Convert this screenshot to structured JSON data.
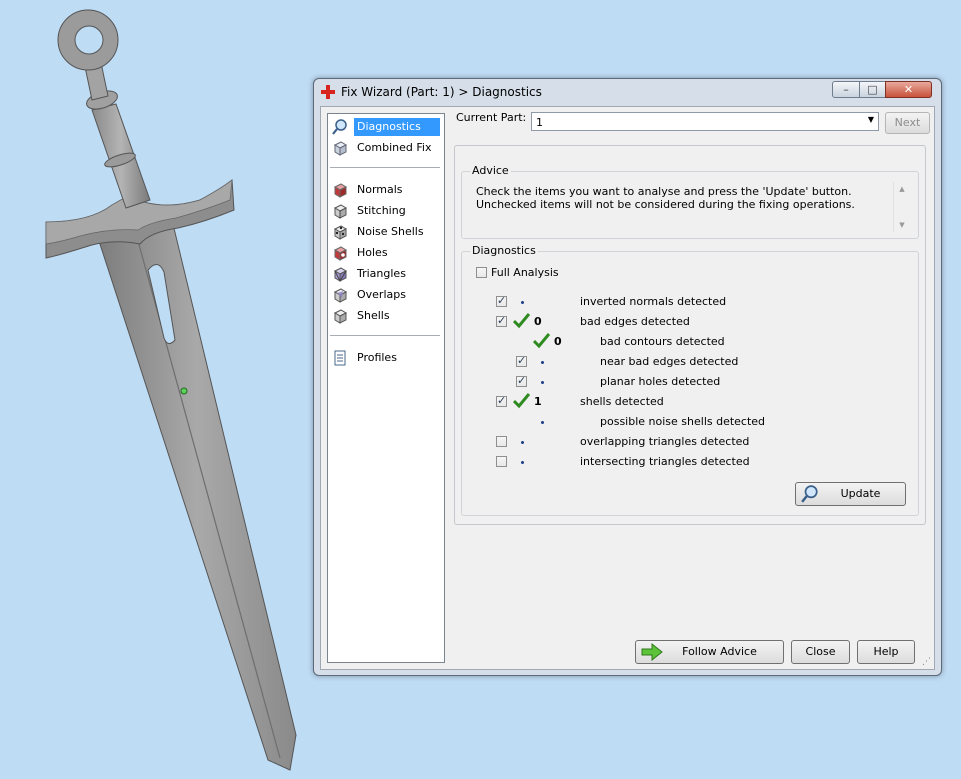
{
  "window": {
    "title": "Fix Wizard (Part: 1) > Diagnostics",
    "controls": {
      "minimize": "–",
      "maximize": "□",
      "close": "✕"
    }
  },
  "sidebar": {
    "top_items": [
      {
        "label": "Diagnostics",
        "icon": "magnifier-icon",
        "selected": true
      },
      {
        "label": "Combined Fix",
        "icon": "cube-icon"
      }
    ],
    "fix_items": [
      {
        "label": "Normals",
        "icon": "normals-cube-icon"
      },
      {
        "label": "Stitching",
        "icon": "stitching-cube-icon"
      },
      {
        "label": "Noise Shells",
        "icon": "noise-shells-icon"
      },
      {
        "label": "Holes",
        "icon": "holes-cube-icon"
      },
      {
        "label": "Triangles",
        "icon": "triangles-cube-icon"
      },
      {
        "label": "Overlaps",
        "icon": "overlaps-cube-icon"
      },
      {
        "label": "Shells",
        "icon": "shells-cube-icon"
      }
    ],
    "bottom_items": [
      {
        "label": "Profiles",
        "icon": "document-icon"
      }
    ]
  },
  "current_part": {
    "label": "Current Part:",
    "value": "1"
  },
  "next_label": "Next",
  "advice": {
    "title": "Advice",
    "text": "Check the items you want to analyse and press the 'Update' button. Unchecked items will not be considered during the fixing operations."
  },
  "diagnostics": {
    "title": "Diagnostics",
    "full_analysis": {
      "label": "Full Analysis",
      "checked": false
    },
    "rows": [
      {
        "label": "inverted normals detected",
        "checked": true,
        "count": "",
        "ok": false
      },
      {
        "label": "bad edges detected",
        "checked": true,
        "count": "0",
        "ok": true
      },
      {
        "label": "bad contours detected",
        "checked": null,
        "count": "0",
        "ok": true
      },
      {
        "label": "near bad edges detected",
        "checked": true,
        "count": "",
        "ok": false
      },
      {
        "label": "planar holes detected",
        "checked": true,
        "count": "",
        "ok": false
      },
      {
        "label": "shells detected",
        "checked": true,
        "count": "1",
        "ok": true
      },
      {
        "label": "possible noise shells detected",
        "checked": null,
        "count": "",
        "ok": false
      },
      {
        "label": "overlapping triangles detected",
        "checked": false,
        "count": "",
        "ok": false
      },
      {
        "label": "intersecting triangles detected",
        "checked": false,
        "count": "",
        "ok": false
      }
    ]
  },
  "buttons": {
    "update": "Update",
    "follow_advice": "Follow Advice",
    "close": "Close",
    "help": "Help"
  },
  "colors": {
    "background": "#bfdcf5",
    "selection": "#3399ff",
    "ok_check": "#2e8b1f",
    "model_gray": "#9a9a9a"
  }
}
